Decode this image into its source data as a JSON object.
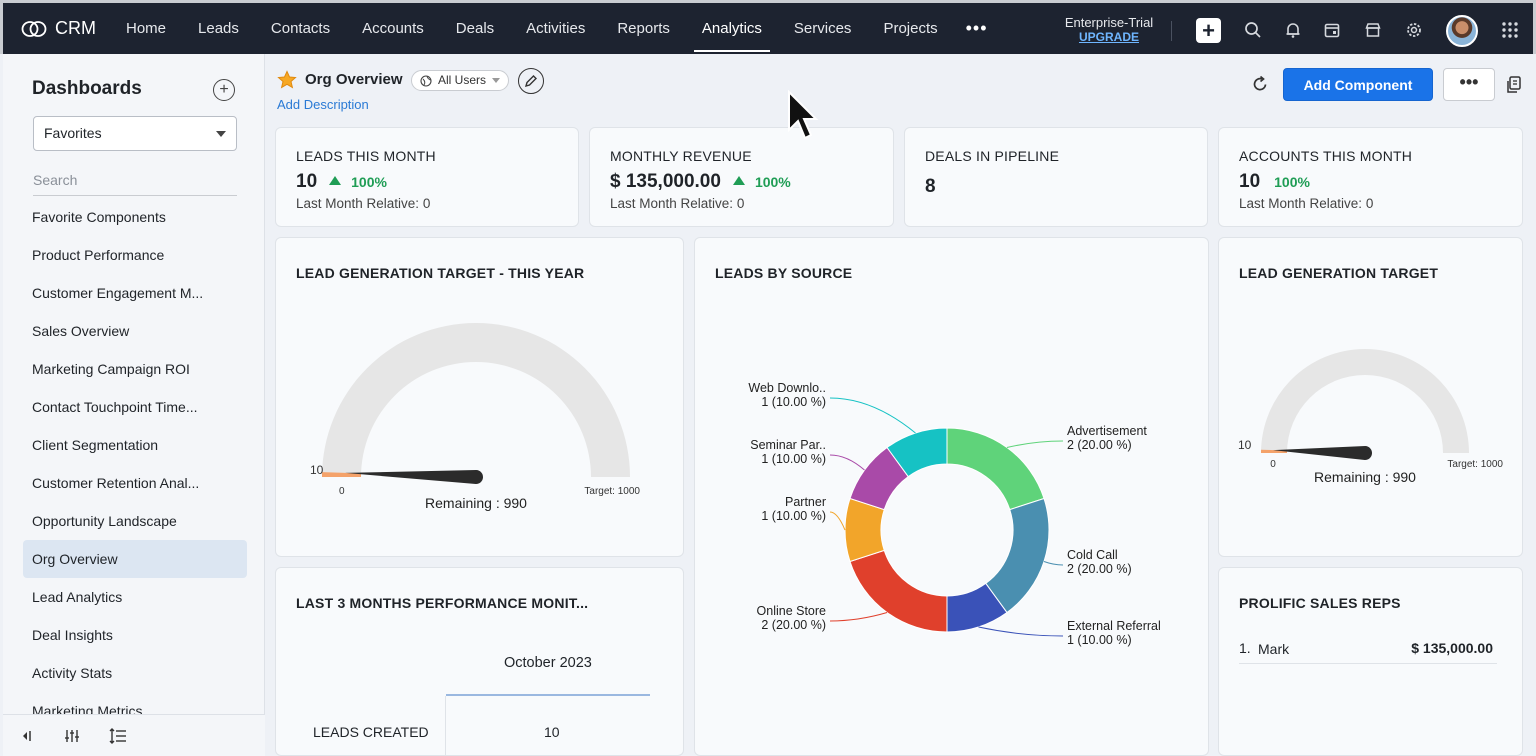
{
  "topbar": {
    "app_name": "CRM",
    "nav": [
      "Home",
      "Leads",
      "Contacts",
      "Accounts",
      "Deals",
      "Activities",
      "Reports",
      "Analytics",
      "Services",
      "Projects"
    ],
    "active_nav": "Analytics",
    "more": "•••",
    "trial_label": "Enterprise-Trial",
    "upgrade_label": "UPGRADE"
  },
  "sidebar": {
    "title": "Dashboards",
    "filter_value": "Favorites",
    "search_placeholder": "Search",
    "items": [
      "Favorite Components",
      "Product Performance",
      "Customer Engagement M...",
      "Sales Overview",
      "Marketing Campaign ROI",
      "Contact Touchpoint Time...",
      "Client Segmentation",
      "Customer Retention Anal...",
      "Opportunity Landscape",
      "Org Overview",
      "Lead Analytics",
      "Deal Insights",
      "Activity Stats",
      "Marketing Metrics"
    ],
    "active_item": "Org Overview"
  },
  "header": {
    "title": "Org Overview",
    "users": "All Users",
    "add_description": "Add Description",
    "add_component": "Add Component",
    "more": "•••"
  },
  "kpis": [
    {
      "title": "LEADS THIS MONTH",
      "value": "10",
      "pct": "100%",
      "up_arrow": true,
      "sub": "Last Month Relative: 0"
    },
    {
      "title": "MONTHLY REVENUE",
      "value": "$ 135,000.00",
      "pct": "100%",
      "up_arrow": true,
      "sub": "Last Month Relative: 0"
    },
    {
      "title": "DEALS IN PIPELINE",
      "value": "8",
      "pct": "",
      "up_arrow": false,
      "sub": ""
    },
    {
      "title": "ACCOUNTS THIS MONTH",
      "value": "10",
      "pct": "100%",
      "up_arrow": false,
      "sub": "Last Month Relative: 0"
    }
  ],
  "gauge_year": {
    "title": "LEAD GENERATION TARGET - THIS YEAR",
    "value": 10,
    "min": 0,
    "target": 1000,
    "value_label": "10",
    "min_label": "0",
    "target_label": "Target: 1000",
    "remaining": "Remaining : 990"
  },
  "gauge_small": {
    "title": "LEAD GENERATION TARGET",
    "value": 10,
    "min": 0,
    "target": 1000,
    "value_label": "10",
    "min_label": "0",
    "target_label": "Target: 1000",
    "remaining": "Remaining : 990"
  },
  "leads_by_source": {
    "title": "LEADS BY SOURCE",
    "slices": [
      {
        "name": "Advertisement",
        "value": 2,
        "label": "2 (20.00 %)",
        "color": "#5fd37a"
      },
      {
        "name": "Cold Call",
        "value": 2,
        "label": "2 (20.00 %)",
        "color": "#4a8fb0"
      },
      {
        "name": "External Referral",
        "value": 1,
        "label": "1 (10.00 %)",
        "color": "#3a52b8"
      },
      {
        "name": "Online Store",
        "value": 2,
        "label": "2 (20.00 %)",
        "color": "#e0402c"
      },
      {
        "name": "Partner",
        "value": 1,
        "label": "1 (10.00 %)",
        "color": "#f2a52a"
      },
      {
        "name": "Seminar Par..",
        "value": 1,
        "label": "1 (10.00 %)",
        "color": "#a94aa8"
      },
      {
        "name": "Web Downlo..",
        "value": 1,
        "label": "1 (10.00 %)",
        "color": "#16c2c4"
      }
    ]
  },
  "performance": {
    "title": "LAST 3 MONTHS PERFORMANCE MONIT...",
    "month": "October 2023",
    "row_label": "LEADS CREATED",
    "row_value": "10"
  },
  "sales_reps": {
    "title": "PROLIFIC SALES REPS",
    "rows": [
      {
        "num": "1.",
        "name": "Mark",
        "amount": "$ 135,000.00"
      }
    ]
  }
}
